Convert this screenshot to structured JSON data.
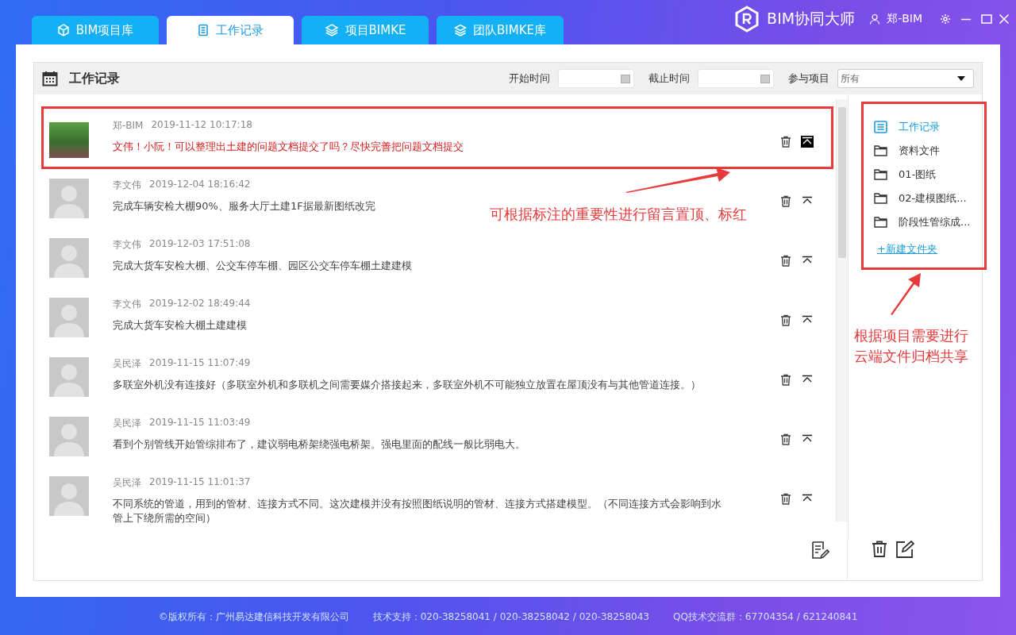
{
  "tabs": [
    {
      "label": "BIM项目库",
      "selected": false
    },
    {
      "label": "工作记录",
      "selected": true
    },
    {
      "label": "项目BIMKE",
      "selected": false
    },
    {
      "label": "团队BIMKE库",
      "selected": false
    }
  ],
  "brand": {
    "title": "BIM协同大师",
    "user": "郑-BIM"
  },
  "panel": {
    "title": "工作记录",
    "start_label": "开始时间",
    "end_label": "截止时间",
    "project_label": "参与项目",
    "project_value": "所有"
  },
  "records": [
    {
      "author": "郑-BIM",
      "time": "2019-11-12 10:17:18",
      "text": "文伟！小阮！可以整理出土建的问题文档提交了吗？尽快完善把问题文档提交",
      "pinned": true,
      "kind": "photo"
    },
    {
      "author": "李文伟",
      "time": "2019-12-04 18:16:42",
      "text": "完成车辆安检大棚90%、服务大厅土建1F据最新图纸改完",
      "pinned": false,
      "kind": "default"
    },
    {
      "author": "李文伟",
      "time": "2019-12-03 17:51:08",
      "text": "完成大货车安检大棚、公交车停车棚、园区公交车停车棚土建建模",
      "pinned": false,
      "kind": "default"
    },
    {
      "author": "李文伟",
      "time": "2019-12-02 18:49:44",
      "text": "完成大货车安检大棚土建建模",
      "pinned": false,
      "kind": "default"
    },
    {
      "author": "吴民泽",
      "time": "2019-11-15 11:07:49",
      "text": "多联室外机没有连接好（多联室外机和多联机之间需要媒介搭接起来，多联室外机不可能独立放置在屋顶没有与其他管道连接。）",
      "pinned": false,
      "kind": "default"
    },
    {
      "author": "吴民泽",
      "time": "2019-11-15 11:03:49",
      "text": "看到个别管线开始管综排布了，建议弱电桥架绕强电桥架。强电里面的配线一般比弱电大。",
      "pinned": false,
      "kind": "default"
    },
    {
      "author": "吴民泽",
      "time": "2019-11-15 11:01:37",
      "text": "不同系统的管道，用到的管材、连接方式不同。这次建模并没有按照图纸说明的管材、连接方式搭建模型。（不同连接方式会影响到水管上下绕所需的空间）",
      "pinned": false,
      "kind": "default"
    }
  ],
  "folders": [
    {
      "label": "工作记录",
      "selected": true,
      "kind": "log"
    },
    {
      "label": "资料文件",
      "selected": false,
      "kind": "folder"
    },
    {
      "label": "01-图纸",
      "selected": false,
      "kind": "folder"
    },
    {
      "label": "02-建模图纸...",
      "selected": false,
      "kind": "folder"
    },
    {
      "label": "阶段性管综成...",
      "selected": false,
      "kind": "folder"
    }
  ],
  "new_folder": "+新建文件夹",
  "annotations": [
    "可根据标注的重要性进行留言置顶、标红",
    "根据项目需要进行云端文件归档共享"
  ],
  "footer": [
    "©版权所有：广州易达建信科技开发有限公司",
    "技术支持：020-38258041 / 020-38258042 / 020-38258043",
    "QQ技术交流群：67704354 / 621240841"
  ]
}
